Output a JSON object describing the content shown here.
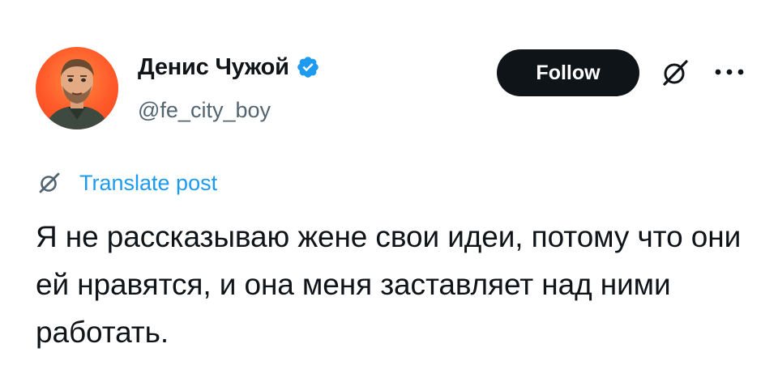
{
  "author": {
    "display_name": "Денис Чужой",
    "handle": "@fe_city_boy",
    "verified": true,
    "avatar_icon": "profile-photo"
  },
  "actions": {
    "follow_label": "Follow",
    "grok_icon": "grok-icon",
    "more_icon": "more-icon"
  },
  "translate": {
    "label": "Translate post",
    "icon": "grok-translate-icon"
  },
  "post": {
    "text": "Я не рассказываю жене свои идеи, потому что они ей нравятся, и она меня заставляет над ними работать."
  },
  "colors": {
    "accent": "#1d9bf0",
    "text": "#0f1419",
    "secondary": "#536471",
    "button_bg": "#0f1419"
  }
}
